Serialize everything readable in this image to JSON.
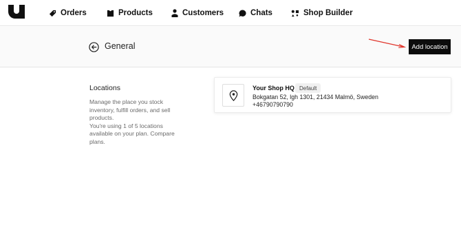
{
  "nav": {
    "items": [
      {
        "label": "Orders",
        "icon": "tag-icon"
      },
      {
        "label": "Products",
        "icon": "shirt-icon"
      },
      {
        "label": "Customers",
        "icon": "person-icon"
      },
      {
        "label": "Chats",
        "icon": "chat-bubble-icon"
      },
      {
        "label": "Shop Builder",
        "icon": "builder-icon"
      }
    ]
  },
  "header": {
    "back_icon": "arrow-left-circle-icon",
    "title": "General",
    "add_button_label": "Add location"
  },
  "section": {
    "title": "Locations",
    "description_1": "Manage the place you stock inventory, fulfill orders, and sell products.",
    "description_2": "You're using 1 of 5 locations available on your plan. Compare plans."
  },
  "location": {
    "icon": "map-pin-icon",
    "name": "Your Shop HQ",
    "badge": "Default",
    "address": "Bokgatan 52, lgh 1301, 21434 Malmö, Sweden",
    "phone": "+46790790790"
  },
  "colors": {
    "accent": "#0c0c0c",
    "annotation_arrow": "#e0352b",
    "badge_bg": "#f0f0f0"
  }
}
